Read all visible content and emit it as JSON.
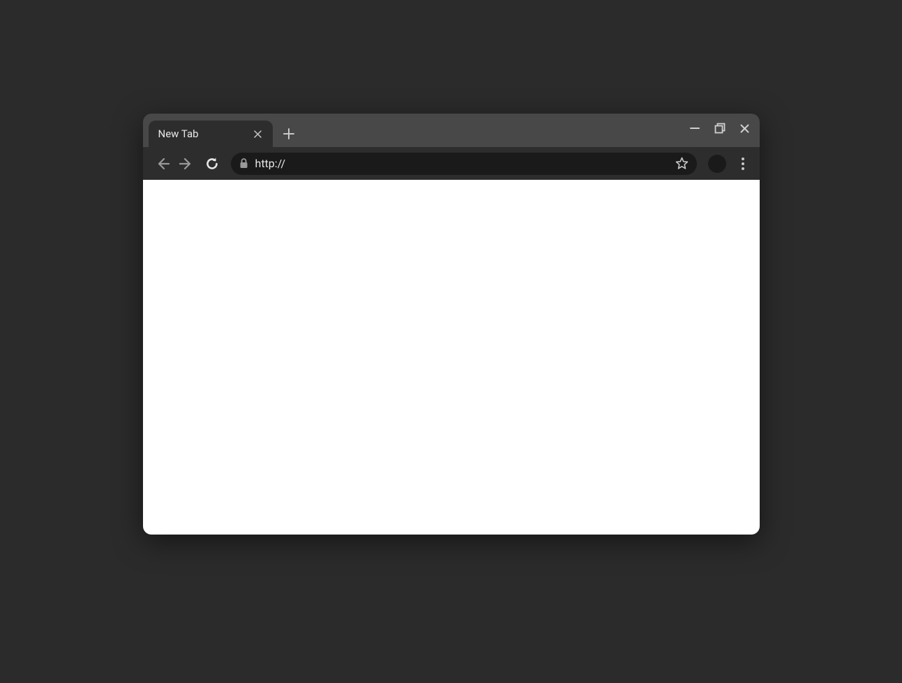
{
  "tab": {
    "title": "New Tab"
  },
  "address_bar": {
    "url_value": "http://"
  }
}
